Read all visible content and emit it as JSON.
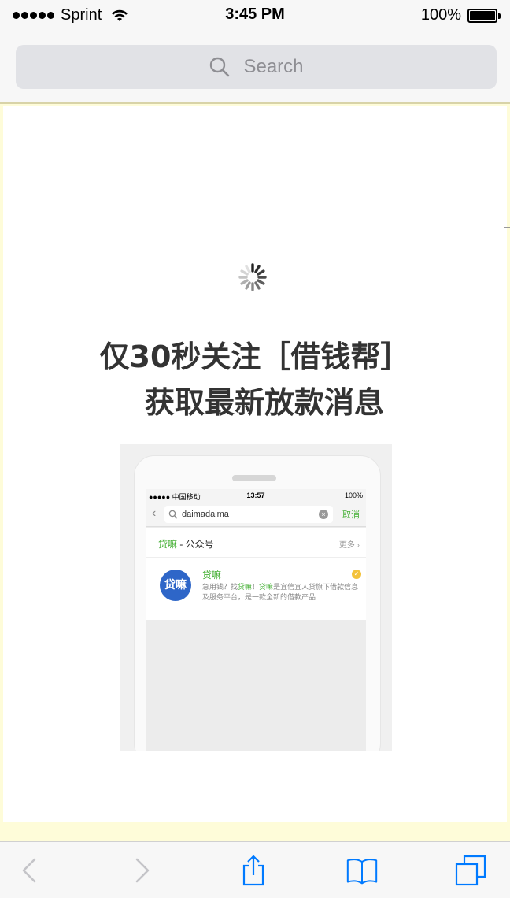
{
  "status_bar": {
    "carrier": "Sprint",
    "time": "3:45 PM",
    "battery": "100%",
    "battery_level": 1.0
  },
  "search": {
    "placeholder": "Search",
    "icon": "search-icon"
  },
  "content": {
    "headline_line1": "仅30秒关注［借钱帮］",
    "headline_line2": "获取最新放款消息"
  },
  "promo_image": {
    "status": {
      "carrier": "●●●●● 中国移动",
      "time": "13:57",
      "battery": "100%"
    },
    "search_query": "daimadaima",
    "cancel_label": "取消",
    "section_title_brand": "贷嘛",
    "section_title_suffix": " - 公众号",
    "more_label": "更多 ›",
    "result_avatar": "贷嘛",
    "result_name": "贷嘛",
    "result_desc_1": "急用钱？找",
    "result_desc_brand1": "贷嘛",
    "result_desc_2": "！",
    "result_desc_brand2": "贷嘛",
    "result_desc_3": "是宜信宜人贷旗下借款信息及服务平台，是一款全新的借款产品..."
  },
  "toolbar": {
    "items": [
      "back-icon",
      "forward-icon",
      "share-icon",
      "bookmarks-icon",
      "tabs-icon"
    ]
  },
  "colors": {
    "accent": "#007aff",
    "disabled": "#c4c4c8",
    "brand_green": "#45b035",
    "avatar_blue": "#2e66c8"
  }
}
